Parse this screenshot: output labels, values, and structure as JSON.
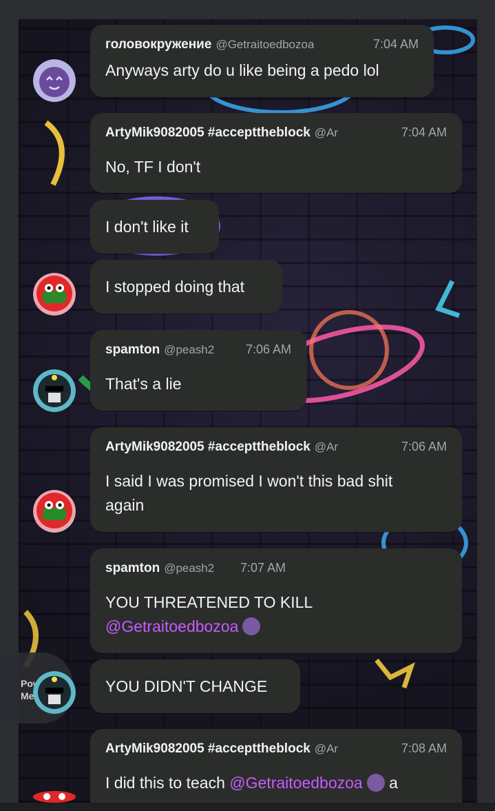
{
  "messages": [
    {
      "author": "головокружение",
      "handle": "@Getraitoedbozoa",
      "time": "7:04 AM",
      "text": "Anyways arty do u like being a pedo lol"
    },
    {
      "author": "ArtyMik9082005 #accepttheblock",
      "handle": "@Ar",
      "time": "7:04 AM",
      "text": "No, TF I don't"
    },
    {
      "text": "I don't like it"
    },
    {
      "text": "I stopped doing that"
    },
    {
      "author": "spamton",
      "handle": "@peash2",
      "time": "7:06 AM",
      "text": "That's a lie"
    },
    {
      "author": "ArtyMik9082005 #accepttheblock",
      "handle": "@Ar",
      "time": "7:06 AM",
      "line1": "I said I was promised I won't this bad shit",
      "line2": "again"
    },
    {
      "author": "spamton",
      "handle": "@peash2",
      "time": "7:07 AM",
      "line1": "YOU THREATENED TO KILL",
      "mention": "@Getraitoedbozoa"
    },
    {
      "text": "YOU DIDN'T CHANGE"
    },
    {
      "author": "ArtyMik9082005 #accepttheblock",
      "handle": "@Ar",
      "time": "7:08 AM",
      "prefix": "I did this to teach",
      "mention": "@Getraitoedbozoa",
      "suffix": "a"
    }
  ],
  "power_menu": {
    "line1": "Power",
    "line2": "Menu"
  },
  "icons": {
    "mention_emoji": "purple-face-emoji",
    "avatar_1": "purple-face-avatar",
    "avatar_2": "red-creature-avatar",
    "avatar_3": "spamton-avatar"
  },
  "colors": {
    "bubble": "#2b2d2b",
    "mention": "#c85bff",
    "text": "#f2f3f5",
    "meta": "#a3a6aa"
  }
}
